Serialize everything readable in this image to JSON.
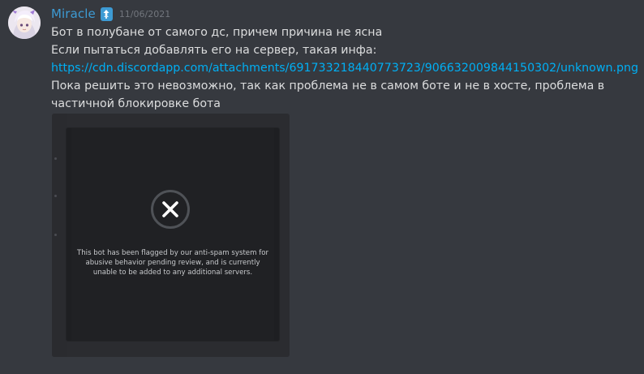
{
  "author": {
    "name": "Miracle",
    "timestamp": "11/06/2021",
    "badge_icon": "booster-badge-icon"
  },
  "message": {
    "lines": [
      "Бот в полубане от самого дс, причем причина не ясна",
      "Если пытаться добавлять его на сервер, такая инфа:"
    ],
    "link": "https://cdn.discordapp.com/attachments/691733218440773723/906632009844150302/unknown.png",
    "paragraph": "Пока решить это невозможно, так как проблема не в самом боте и не в хосте, проблема в частичной блокировке бота"
  },
  "attachment": {
    "icon": "close-icon",
    "text_lines": [
      "This bot has been flagged by our anti-spam system for",
      "abusive behavior pending review, and is currently",
      "unable to be added to any additional servers."
    ]
  },
  "colors": {
    "background": "#36393f",
    "username": "#3d9bd4",
    "link": "#00aff4",
    "text": "#dcddde",
    "timestamp": "#72767d"
  }
}
